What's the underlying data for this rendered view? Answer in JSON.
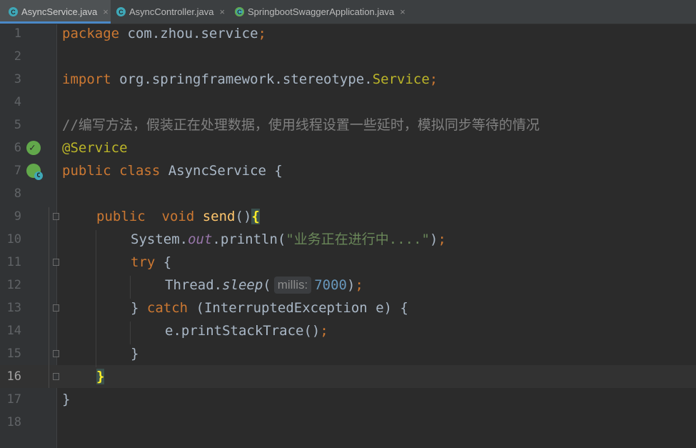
{
  "tabs": [
    {
      "label": "AsyncService.java",
      "icon": "class-icon",
      "active": true
    },
    {
      "label": "AsyncController.java",
      "icon": "class-icon",
      "active": false
    },
    {
      "label": "SpringbootSwaggerApplication.java",
      "icon": "spring-boot-class-icon",
      "active": false
    }
  ],
  "close_glyph": "×",
  "line_numbers": [
    "1",
    "2",
    "3",
    "4",
    "5",
    "6",
    "7",
    "8",
    "9",
    "10",
    "11",
    "12",
    "13",
    "14",
    "15",
    "16",
    "17",
    "18"
  ],
  "code": {
    "l1_kw": "package",
    "l1_rest": " com.zhou.service",
    "l1_semi": ";",
    "l3_kw": "import",
    "l3_rest": " org.springframework.stereotype.",
    "l3_cls": "Service",
    "l3_semi": ";",
    "l5_comment": "//编写方法，假装正在处理数据，使用线程设置一些延时，模拟同步等待的情况",
    "l6_ann": "@Service",
    "l7_kw": "public class",
    "l7_rest": " AsyncService {",
    "l9_kw1": "public",
    "l9_sp": "  ",
    "l9_kw2": "void",
    "l9_fn": " send",
    "l9_paren": "()",
    "l9_brace": "{",
    "l10_pre": "System.",
    "l10_field": "out",
    "l10_mid": ".println(",
    "l10_str": "\"业务正在进行中....\"",
    "l10_end": ")",
    "l10_semi": ";",
    "l11_kw": "try",
    "l11_rest": " {",
    "l12_pre": "Thread.",
    "l12_method": "sleep",
    "l12_paren": "(",
    "l12_hint": "millis:",
    "l12_num": "7000",
    "l12_end": ")",
    "l12_semi": ";",
    "l13_pre": "} ",
    "l13_kw": "catch",
    "l13_rest": " (InterruptedException e) {",
    "l14_pre": "e.printStackTrace()",
    "l14_semi": ";",
    "l15_text": "}",
    "l16_brace": "}",
    "l17_text": "}"
  },
  "colors": {
    "background": "#2b2b2b",
    "keyword": "#cc7832",
    "annotation": "#bbb529",
    "string": "#6a8759",
    "number": "#6897bb",
    "comment": "#808080",
    "function": "#ffc66d",
    "active_tab_underline": "#4a88c7"
  },
  "current_line": "16"
}
